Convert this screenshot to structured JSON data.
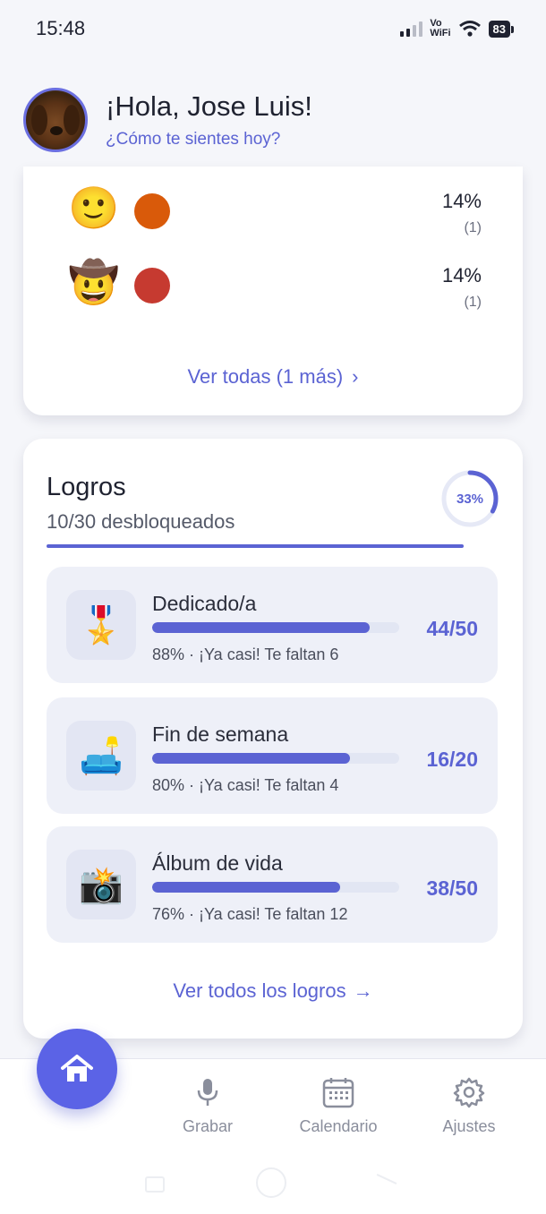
{
  "status_bar": {
    "time": "15:48",
    "network_label_top": "Vo",
    "network_label_bottom": "WiFi",
    "wifi_sub": "6",
    "battery": "83"
  },
  "header": {
    "greeting": "¡Hola, Jose Luis!",
    "subtitle": "¿Cómo te sientes hoy?"
  },
  "moods": {
    "items": [
      {
        "emoji": "🙂",
        "color": "#d95a0a",
        "percent": "14%",
        "count": "(1)"
      },
      {
        "emoji": "🤠",
        "color": "#c63a30",
        "percent": "14%",
        "count": "(1)"
      }
    ],
    "see_all": "Ver todas (1 más)",
    "see_all_icon": "chevron-right-icon"
  },
  "achievements": {
    "title": "Logros",
    "subtitle": "10/30 desbloqueados",
    "progress_label": "33%",
    "progress_value": 0.33,
    "items": [
      {
        "icon": "🎖️",
        "name": "Dedicado/a",
        "progress": 0.88,
        "meta": "88% · ¡Ya casi! Te faltan 6",
        "score": "44/50"
      },
      {
        "icon": "🛋️",
        "name": "Fin de semana",
        "progress": 0.8,
        "meta": "80% · ¡Ya casi! Te faltan 4",
        "score": "16/20"
      },
      {
        "icon": "📸",
        "name": "Álbum de vida",
        "progress": 0.76,
        "meta": "76% · ¡Ya casi! Te faltan 12",
        "score": "38/50"
      }
    ],
    "see_all": "Ver todos los logros",
    "see_all_icon": "arrow-right-icon"
  },
  "nav": {
    "home_icon": "home-icon",
    "items": [
      {
        "label": "Grabar",
        "icon": "microphone-icon"
      },
      {
        "label": "Calendario",
        "icon": "calendar-icon"
      },
      {
        "label": "Ajustes",
        "icon": "gear-icon"
      }
    ]
  },
  "colors": {
    "accent": "#5b63d3",
    "fab": "#5b63e6",
    "card": "#ffffff",
    "background": "#f5f6fa"
  }
}
